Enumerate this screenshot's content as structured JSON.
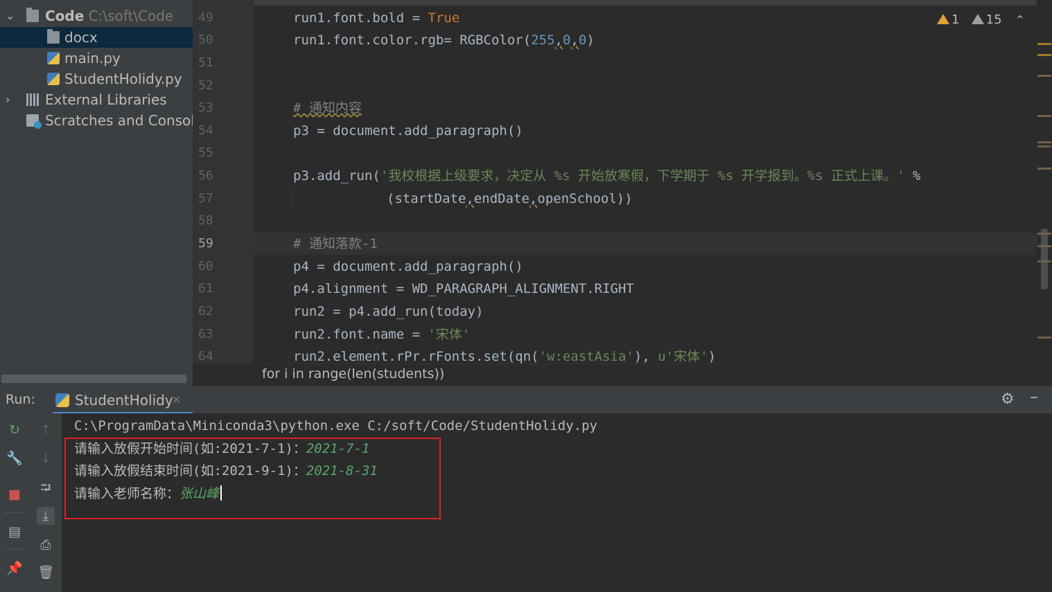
{
  "project_tree": {
    "root": {
      "label": "Code",
      "path": "C:\\soft\\Code"
    },
    "items": [
      {
        "label": "docx",
        "type": "folder"
      },
      {
        "label": "main.py",
        "type": "python-file"
      },
      {
        "label": "StudentHolidy.py",
        "type": "python-file"
      }
    ],
    "external_libraries": "External Libraries",
    "scratches": "Scratches and Consoles"
  },
  "editor": {
    "line_numbers": [
      "49",
      "50",
      "51",
      "52",
      "53",
      "54",
      "55",
      "56",
      "57",
      "58",
      "59",
      "60",
      "61",
      "62",
      "63",
      "64"
    ],
    "current_line": "59",
    "code": {
      "l49_a": "run1.font.bold = ",
      "l49_b": "True",
      "l50_a": "run1.font.color.rgb",
      "l50_b": "= RGBColor(",
      "l50_n1": "255",
      "l50_n2": "0",
      "l50_n3": "0",
      "l53": "# 通知内容",
      "l54": "p3 = document.add_paragraph()",
      "l56_a": "p3.add_run(",
      "l56_s": "'我校根据上级要求，决定从 %s 开始放寒假，下学期于 %s 开学报到。%s 正式上课。'",
      "l56_b": " %",
      "l57_a": "(startDate",
      "l57_b": "endDate",
      "l57_c": "openSchool))",
      "l59": "# 通知落款-1",
      "l60": "p4 = document.add_paragraph()",
      "l61": "p4.alignment = WD_PARAGRAPH_ALIGNMENT.RIGHT",
      "l62": "run2 = p4.add_run(today)",
      "l63_a": "run2.font.name = ",
      "l63_s": "'宋体'",
      "l64_a": "run2.element.rPr.rFonts.set(qn(",
      "l64_s1": "'w:eastAsia'",
      "l64_b": ")",
      "l64_s2": "u'宋体'",
      "l64_c": ")"
    },
    "inspections": {
      "warnings": "1",
      "weak_warnings": "15"
    },
    "breadcrumb": "for i in range(len(students))"
  },
  "run_window": {
    "label": "Run:",
    "tab": "StudentHolidy",
    "console": {
      "command": "C:\\ProgramData\\Miniconda3\\python.exe C:/soft/Code/StudentHolidy.py",
      "lines": [
        {
          "prompt": "请输入放假开始时间(如:2021-7-1)：",
          "input": "2021-7-1"
        },
        {
          "prompt": "请输入放假结束时间(如:2021-9-1)：",
          "input": "2021-8-31"
        },
        {
          "prompt": "请输入老师名称：",
          "input": "张山峰"
        }
      ]
    }
  },
  "colors": {
    "highlight_box": "#e0202a",
    "input_text": "#59a869",
    "selection": "#0d293e"
  }
}
